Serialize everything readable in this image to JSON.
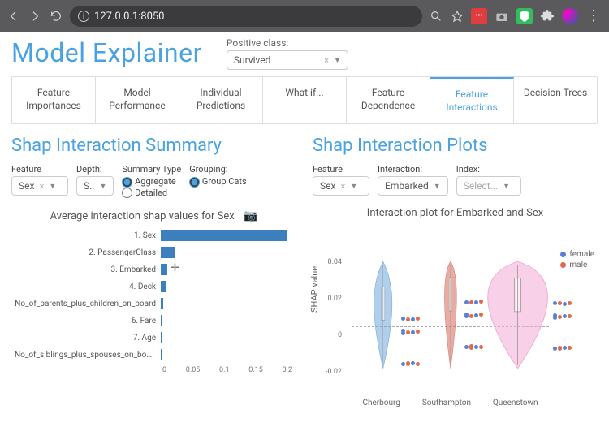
{
  "browser": {
    "url": "127.0.0.1:8050"
  },
  "header": {
    "title": "Model Explainer",
    "positive_class_label": "Positive class:",
    "positive_class_value": "Survived"
  },
  "tabs": [
    {
      "label": "Feature Importances"
    },
    {
      "label": "Model Performance"
    },
    {
      "label": "Individual Predictions"
    },
    {
      "label": "What if..."
    },
    {
      "label": "Feature Dependence"
    },
    {
      "label": "Feature Interactions",
      "active": true
    },
    {
      "label": "Decision Trees"
    }
  ],
  "left": {
    "heading": "Shap Interaction Summary",
    "controls": {
      "feature_label": "Feature",
      "feature_value": "Sex",
      "depth_label": "Depth:",
      "depth_value": "S..",
      "summary_label": "Summary Type",
      "summary_aggregate": "Aggregate",
      "summary_detailed": "Detailed",
      "grouping_label": "Grouping:",
      "grouping_cats": "Group Cats"
    },
    "chart_title": "Average interaction shap values for Sex"
  },
  "right": {
    "heading": "Shap Interaction Plots",
    "controls": {
      "feature_label": "Feature",
      "feature_value": "Sex",
      "interaction_label": "Interaction:",
      "interaction_value": "Embarked",
      "index_label": "Index:",
      "index_placeholder": "Select..."
    },
    "chart_title": "Interaction plot for Embarked and Sex",
    "ylabel": "SHAP value",
    "legend": {
      "female": "female",
      "male": "male"
    }
  },
  "colors": {
    "female": "#5b7fd6",
    "male": "#e06b4a",
    "pink": "#f2a9d6",
    "blue": "#6fa8d8",
    "red": "#d46a5a"
  },
  "chart_data": [
    {
      "type": "bar",
      "title": "Average interaction shap values for Sex",
      "xlabel": "",
      "ylabel": "",
      "xlim": [
        0,
        0.2
      ],
      "xticks": [
        0,
        0.05,
        0.1,
        0.15,
        0.2
      ],
      "categories": [
        "1. Sex",
        "2. PassengerClass",
        "3. Embarked",
        "4. Deck",
        "No_of_parents_plus_children_on_board",
        "6. Fare",
        "7. Age",
        "No_of_siblings_plus_spouses_on_board"
      ],
      "values": [
        0.195,
        0.023,
        0.01,
        0.007,
        0.004,
        0.003,
        0.003,
        0.002
      ]
    },
    {
      "type": "violin",
      "title": "Interaction plot for Embarked and Sex",
      "ylabel": "SHAP value",
      "ylim": [
        -0.03,
        0.05
      ],
      "yticks": [
        -0.02,
        0,
        0.02,
        0.04
      ],
      "categories": [
        "Cherbourg",
        "Southampton",
        "Queenstown"
      ],
      "legend": [
        "female",
        "male"
      ],
      "series_notes": "Violin bodies with scatter points colored by sex; Cherbourg centered near -0.01, Southampton near 0.005, Queenstown broad around 0"
    }
  ]
}
